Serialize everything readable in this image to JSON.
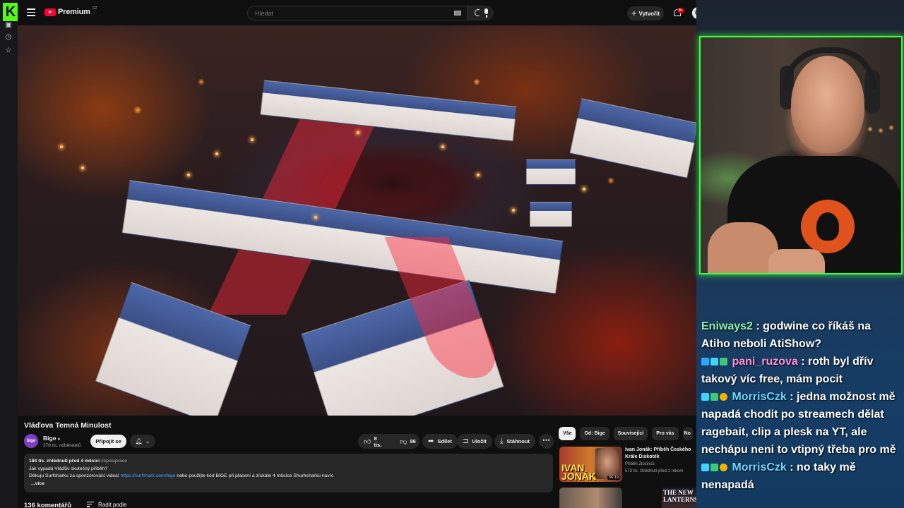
{
  "youtube": {
    "brand": "Premium",
    "brand_country": "CZ",
    "search_placeholder": "Hledat",
    "create_label": "Vytvořit",
    "notification_count": "9+",
    "video": {
      "title": "Vláďova Temná Minulost",
      "channel_name": "Bige",
      "channel_avatar_text": "bige",
      "subscribers": "378 tis. odběratelů",
      "join_label": "Připojit se",
      "likes": "8 tis.",
      "dislikes": "86",
      "share_label": "Sdílet",
      "save_label": "Uložit",
      "download_label": "Stáhnout"
    },
    "description": {
      "meta": "184 tis. zhlédnutí  před 4 měsíci",
      "hashtag": "#spoluprace",
      "line1": "Jak vypadá Vláďův skutečný příběh?",
      "line2_prefix": "Děkuju Surfsharku za sponzorování videa!",
      "link": "https://surfshark.com/bige",
      "line2_suffix": "nebo použijte kód BIGE při placení a získáte 4 měsíce Shurhsharku navíc",
      "more": "...více"
    },
    "comments": {
      "count_label": "136 komentářů",
      "sort_label": "Řadit podle"
    },
    "chips": [
      "Vše",
      "Od: Bige",
      "Související",
      "Pro vás",
      "No"
    ],
    "related": [
      {
        "thumb_text": "IVAN JONÁK",
        "duration": "56:19",
        "title": "Ivan Jonák: Příběh Českého Krále Diskoték",
        "channel": "Příběh Zločinců",
        "views": "573 tis. zhlédnutí  před 1 rokem"
      },
      {
        "thumb_text": "THE NEW LANTERNS"
      }
    ]
  },
  "chat": [
    {
      "user": "Eniways2",
      "message": "godwine co říkáš na Atiho neboli AtiShow?",
      "color": "#8cf2a8"
    },
    {
      "user": "pani_ruzova",
      "message": "roth byl dřív takový víc free, mám pocit",
      "color": "#ff8fdc"
    },
    {
      "user": "MorrisCzk",
      "message": "jedna možnost mě napadá chodit po streamech dělat ragebait, clip a plesk na YT, ale nechápu neni to vtipný třeba pro mě",
      "color": "#6bd6ff"
    },
    {
      "user": "MorrisCzk",
      "message": "no taky mě nenapadá",
      "color": "#6bd6ff"
    }
  ],
  "colors": {
    "kick_green": "#53fc18",
    "youtube_red": "#ff0033",
    "cam_border": "#3cff3c",
    "link_blue": "#3ea6ff"
  }
}
